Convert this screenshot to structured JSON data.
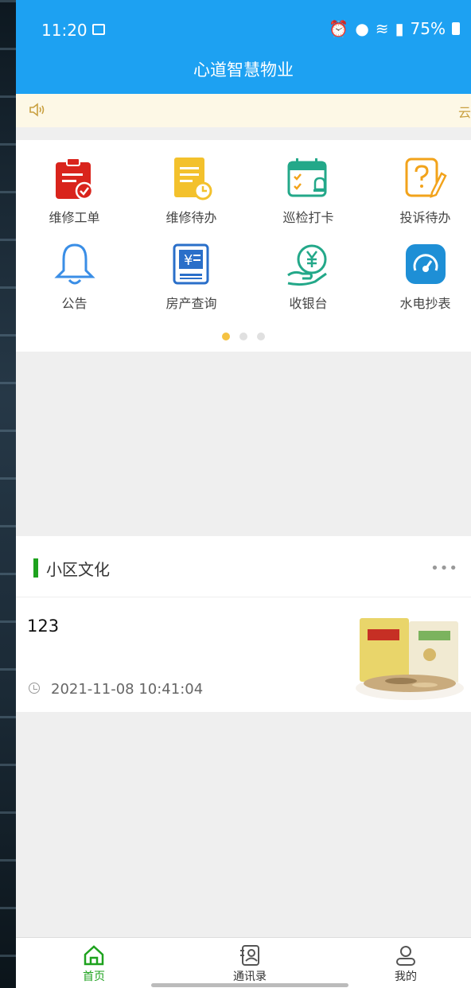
{
  "status_bar": {
    "time": "11:20",
    "battery": "75%"
  },
  "app_title": "心道智慧物业",
  "notice": {
    "marquee_text": "云"
  },
  "menu": {
    "items": [
      {
        "label": "维修工单",
        "icon": "repair-order-icon",
        "color": "#d9241c"
      },
      {
        "label": "维修待办",
        "icon": "repair-todo-icon",
        "color": "#f3c12c"
      },
      {
        "label": "巡检打卡",
        "icon": "inspection-checkin-icon",
        "color": "#23a889"
      },
      {
        "label": "投诉待办",
        "icon": "complaint-todo-icon",
        "color": "#f2a31b"
      },
      {
        "label": "公告",
        "icon": "announcement-bell-icon",
        "color": "#3a8ee6"
      },
      {
        "label": "房产查询",
        "icon": "property-query-icon",
        "color": "#2a6fc9"
      },
      {
        "label": "收银台",
        "icon": "cashier-icon",
        "color": "#23a889"
      },
      {
        "label": "水电抄表",
        "icon": "meter-reading-icon",
        "color": "#1e8fd6"
      }
    ],
    "page_indicator": {
      "pages": 3,
      "active": 1,
      "active_color": "#f5c242"
    }
  },
  "culture": {
    "title": "小区文化",
    "accent_color": "#1ea21e",
    "articles": [
      {
        "title": "123",
        "time": "2021-11-08 10:41:04"
      }
    ]
  },
  "tabs": [
    {
      "label": "首页",
      "icon": "home-icon",
      "active": true
    },
    {
      "label": "通讯录",
      "icon": "contacts-icon",
      "active": false
    },
    {
      "label": "我的",
      "icon": "profile-icon",
      "active": false
    }
  ]
}
